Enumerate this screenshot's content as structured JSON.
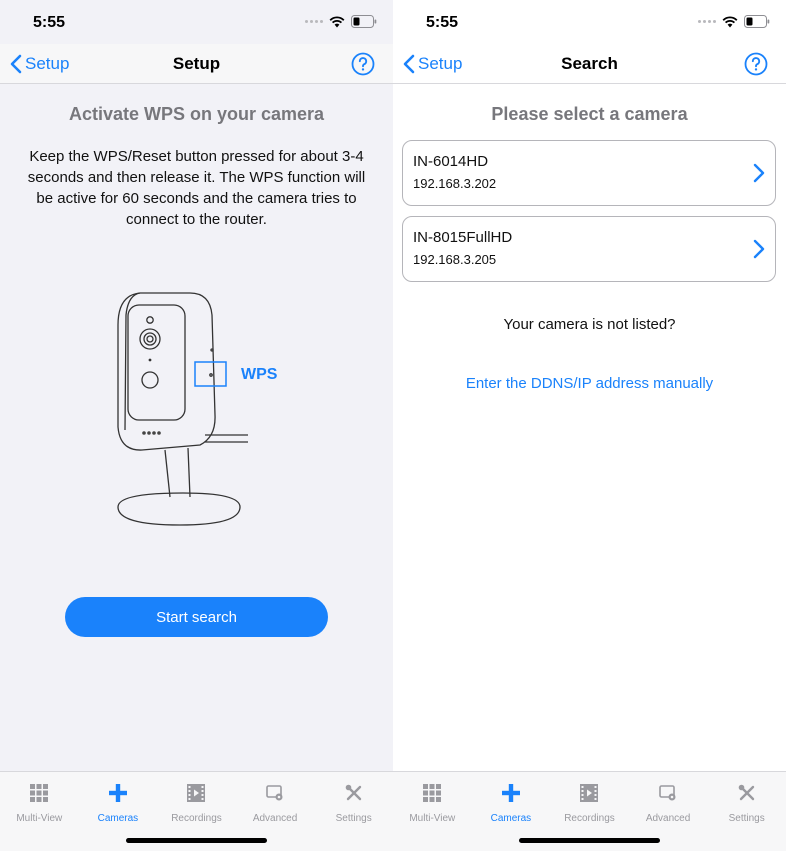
{
  "colors": {
    "accent": "#1a82fb",
    "inactive_tab": "#9a9a9f",
    "title_gray": "#77777c"
  },
  "status_bar": {
    "time": "5:55"
  },
  "left_screen": {
    "nav": {
      "back_label": "Setup",
      "title": "Setup",
      "help_icon": "question-circle-icon"
    },
    "title": "Activate WPS on your camera",
    "description": "Keep the WPS/Reset button pressed for about 3-4 seconds and then release it. The WPS function will be active for 60 seconds and the camera tries to connect to the router.",
    "wps_label": "WPS",
    "start_button_label": "Start search"
  },
  "right_screen": {
    "nav": {
      "back_label": "Setup",
      "title": "Search",
      "help_icon": "question-circle-icon"
    },
    "title": "Please select a camera",
    "cameras": [
      {
        "name": "IN-6014HD",
        "ip": "192.168.3.202"
      },
      {
        "name": "IN-8015FullHD",
        "ip": "192.168.3.205"
      }
    ],
    "not_listed_text": "Your camera is not listed?",
    "manual_link": "Enter the DDNS/IP address manually"
  },
  "tab_bar": {
    "tabs": [
      {
        "label": "Multi-View",
        "icon": "grid-icon",
        "active": false
      },
      {
        "label": "Cameras",
        "icon": "plus-icon",
        "active": true
      },
      {
        "label": "Recordings",
        "icon": "film-icon",
        "active": false
      },
      {
        "label": "Advanced",
        "icon": "advanced-camera-icon",
        "active": false
      },
      {
        "label": "Settings",
        "icon": "tools-icon",
        "active": false
      }
    ]
  }
}
